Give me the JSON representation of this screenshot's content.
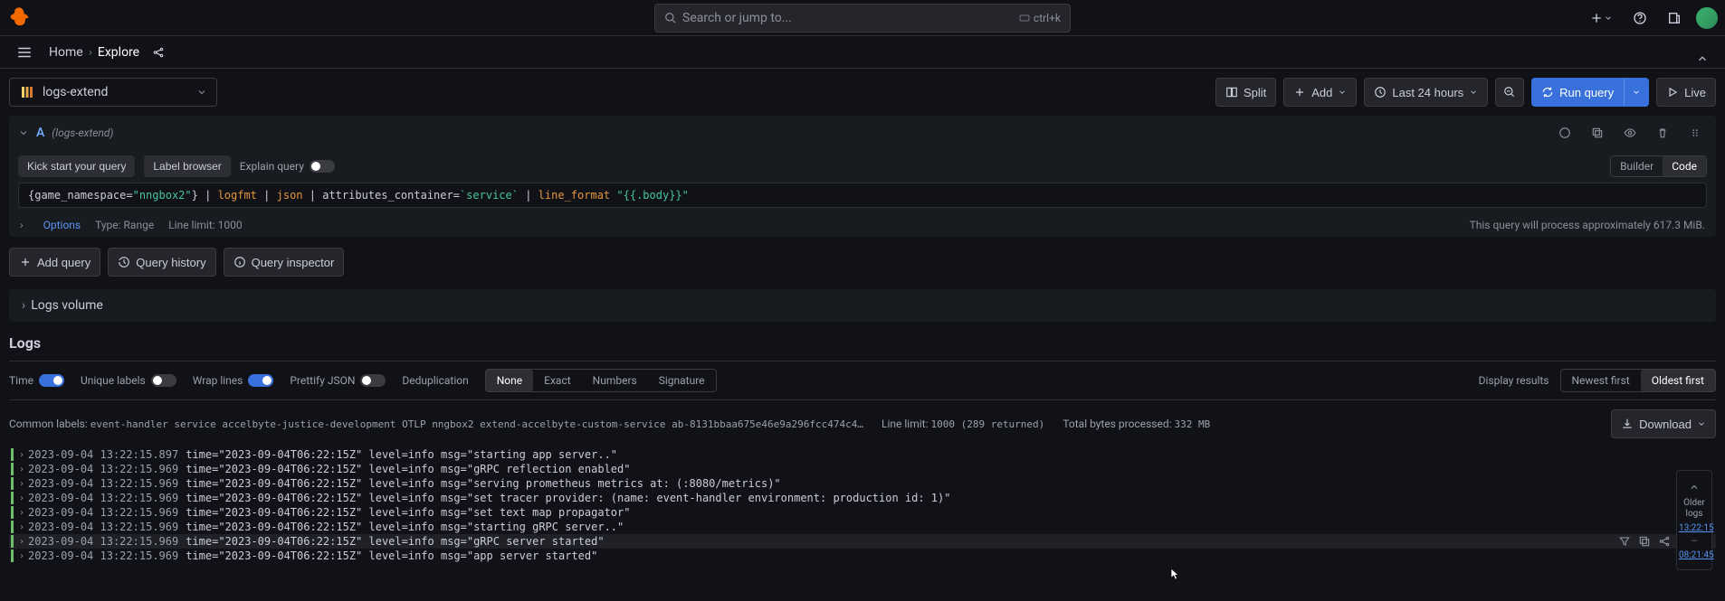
{
  "topbar": {
    "search_placeholder": "Search or jump to...",
    "shortcut": "ctrl+k"
  },
  "breadcrumb": {
    "home": "Home",
    "current": "Explore"
  },
  "toolbar": {
    "datasource": "logs-extend",
    "split": "Split",
    "add": "Add",
    "time_range": "Last 24 hours",
    "run_query": "Run query",
    "live": "Live"
  },
  "query": {
    "letter": "A",
    "ds_label": "(logs-extend)",
    "kick_start": "Kick start your query",
    "label_browser": "Label browser",
    "explain": "Explain query",
    "builder": "Builder",
    "code": "Code",
    "text": "{game_namespace=\"nngbox2\"} | logfmt | json | attributes_container=`service` | line_format \"{{.body}}\"",
    "options": "Options",
    "type": "Type: Range",
    "limit": "Line limit: 1000",
    "footer": "This query will process approximately 617.3 MiB."
  },
  "actions": {
    "add_query": "Add query",
    "history": "Query history",
    "inspector": "Query inspector"
  },
  "logs_volume": "Logs volume",
  "logs": {
    "title": "Logs",
    "time": "Time",
    "unique": "Unique labels",
    "wrap": "Wrap lines",
    "prettify": "Prettify JSON",
    "dedup": "Deduplication",
    "dedup_opts": [
      "None",
      "Exact",
      "Numbers",
      "Signature"
    ],
    "display_results": "Display results",
    "newest": "Newest first",
    "oldest": "Oldest first",
    "common_labels": "Common labels:",
    "labels_text": "event-handler  service  accelbyte-justice-development  OTLP  nngbox2  extend-accelbyte-custom-service  ab-8131bbaa675e46e9a296fcc474c4…",
    "line_limit": "Line limit:",
    "line_limit_val": "1000 (289 returned)",
    "bytes": "Total bytes processed:",
    "bytes_val": "332 MB",
    "download": "Download"
  },
  "log_lines": [
    {
      "ts": "2023-09-04 13:22:15.897",
      "body": "time=\"2023-09-04T06:22:15Z\" level=info msg=\"starting app server..\""
    },
    {
      "ts": "2023-09-04 13:22:15.969",
      "body": "time=\"2023-09-04T06:22:15Z\" level=info msg=\"gRPC reflection enabled\""
    },
    {
      "ts": "2023-09-04 13:22:15.969",
      "body": "time=\"2023-09-04T06:22:15Z\" level=info msg=\"serving prometheus metrics at: (:8080/metrics)\""
    },
    {
      "ts": "2023-09-04 13:22:15.969",
      "body": "time=\"2023-09-04T06:22:15Z\" level=info msg=\"set tracer provider: (name: event-handler environment: production id: 1)\""
    },
    {
      "ts": "2023-09-04 13:22:15.969",
      "body": "time=\"2023-09-04T06:22:15Z\" level=info msg=\"set text map propagator\""
    },
    {
      "ts": "2023-09-04 13:22:15.969",
      "body": "time=\"2023-09-04T06:22:15Z\" level=info msg=\"starting gRPC server..\""
    },
    {
      "ts": "2023-09-04 13:22:15.969",
      "body": "time=\"2023-09-04T06:22:15Z\" level=info msg=\"gRPC server started\""
    },
    {
      "ts": "2023-09-04 13:22:15.969",
      "body": "time=\"2023-09-04T06:22:15Z\" level=info msg=\"app server started\""
    }
  ],
  "side_nav": {
    "label": "Older\nlogs",
    "ts_top": "13:22:15",
    "ts_bottom": "08:21:45"
  }
}
